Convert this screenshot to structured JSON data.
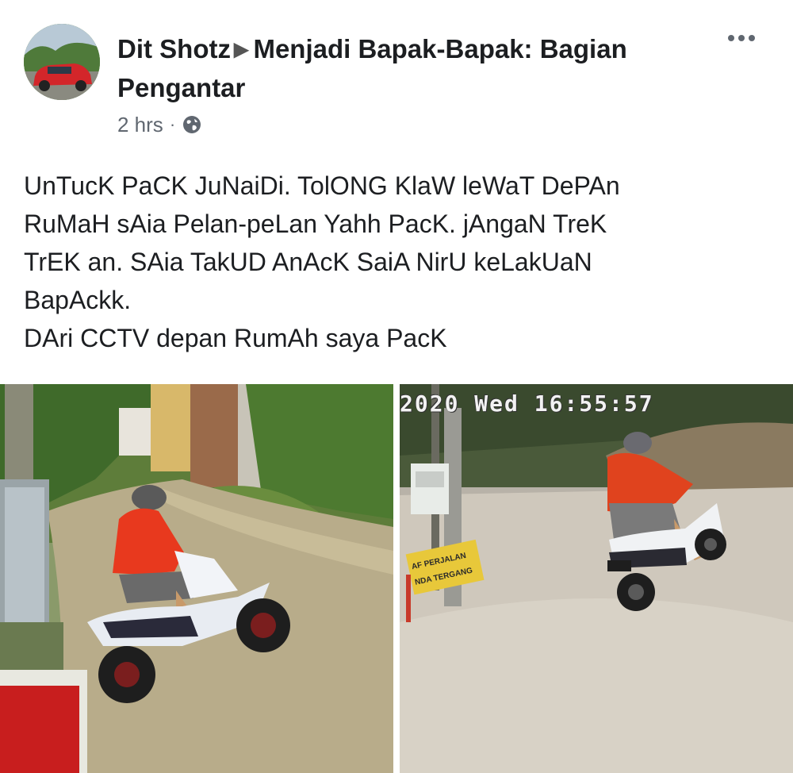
{
  "post": {
    "author": "Dit Shotz",
    "arrow": "▶",
    "group": "Menjadi Bapak-Bapak: Bagian Pengantar",
    "time": "2 hrs",
    "separator": "·",
    "privacy_icon": "globe-icon",
    "more_icon": "more-options-icon",
    "text_lines": [
      "UnTucK PaCK JuNaiDi. TolONG KlaW leWaT DePAn",
      "RuMaH sAia Pelan-peLan Yahh PacK. jAngaN TreK",
      "TrEK an. SAia TakUD AnAcK SaiA NirU keLakUaN",
      "BapAckk.",
      "DAri CCTV depan RumAh saya PacK"
    ]
  },
  "photos": {
    "right": {
      "cctv_timestamp": "2020  Wed  16:55:57",
      "sign_line1": "AF PERJALAN",
      "sign_line2": "NDA TERGANG"
    }
  }
}
